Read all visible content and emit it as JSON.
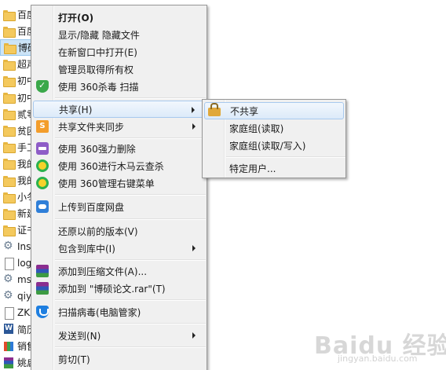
{
  "files": [
    {
      "name": "百度",
      "icon": "folder-icon",
      "selected": false
    },
    {
      "name": "百度",
      "icon": "folder-icon",
      "selected": false
    },
    {
      "name": "博硕",
      "icon": "folder-icon",
      "selected": true
    },
    {
      "name": "超声",
      "icon": "folder-icon",
      "selected": false
    },
    {
      "name": "初中",
      "icon": "folder-icon",
      "selected": false
    },
    {
      "name": "初中",
      "icon": "folder-icon",
      "selected": false
    },
    {
      "name": "贰零",
      "icon": "folder-icon",
      "selected": false
    },
    {
      "name": "贫困",
      "icon": "folder-icon",
      "selected": false
    },
    {
      "name": "手工",
      "icon": "folder-icon",
      "selected": false
    },
    {
      "name": "我的",
      "icon": "folder-icon",
      "selected": false
    },
    {
      "name": "我的",
      "icon": "folder-icon",
      "selected": false
    },
    {
      "name": "小冬",
      "icon": "folder-icon",
      "selected": false
    },
    {
      "name": "新建",
      "icon": "folder-icon",
      "selected": false
    },
    {
      "name": "证书",
      "icon": "folder-icon",
      "selected": false
    },
    {
      "name": "Ins",
      "icon": "gear-icon",
      "selected": false
    },
    {
      "name": "log",
      "icon": "document-icon",
      "selected": false
    },
    {
      "name": "ms",
      "icon": "gear-icon",
      "selected": false
    },
    {
      "name": "qiy",
      "icon": "gear-icon",
      "selected": false
    },
    {
      "name": "ZKX",
      "icon": "document-icon",
      "selected": false
    },
    {
      "name": "简历",
      "icon": "word-icon",
      "selected": false
    },
    {
      "name": "销售",
      "icon": "spreadsheet-icon",
      "selected": false
    },
    {
      "name": "姚启",
      "icon": "rar-icon",
      "selected": false
    }
  ],
  "context_menu": {
    "open": "打开(O)",
    "show_hide": "显示/隐藏 隐藏文件",
    "open_new_window": "在新窗口中打开(E)",
    "take_ownership": "管理员取得所有权",
    "scan_360": "使用 360杀毒 扫描",
    "share": "共享(H)",
    "sync_share": "共享文件夹同步",
    "force_delete": "使用 360强力删除",
    "trojan_scan": "使用 360进行木马云查杀",
    "manage_menu": "使用 360管理右键菜单",
    "upload_baidu": "上传到百度网盘",
    "restore_previous": "还原以前的版本(V)",
    "include_library": "包含到库中(I)",
    "add_archive": "添加到压缩文件(A)...",
    "add_rar": "添加到 \"博硕论文.rar\"(T)",
    "scan_virus": "扫描病毒(电脑管家)",
    "send_to": "发送到(N)",
    "cut": "剪切(T)"
  },
  "share_submenu": {
    "no_share": "不共享",
    "homegroup_read": "家庭组(读取)",
    "homegroup_readwrite": "家庭组(读取/写入)",
    "specific_users": "特定用户..."
  },
  "watermark": {
    "logo": "Baidu 经验",
    "url": "jingyan.baidu.com"
  }
}
